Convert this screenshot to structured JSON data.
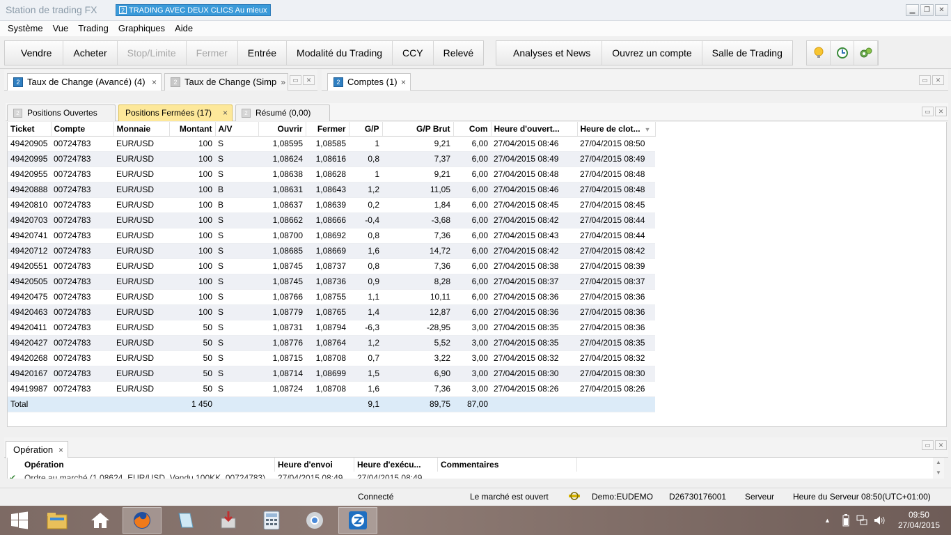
{
  "window": {
    "title": "Station de trading FX",
    "badge_num": "2",
    "badge_text": "TRADING AVEC DEUX CLICS Au mieux",
    "minimize": "▁",
    "restore": "❐",
    "close": "✕"
  },
  "menu": [
    "Système",
    "Vue",
    "Trading",
    "Graphiques",
    "Aide"
  ],
  "toolbar": {
    "group1": [
      {
        "label": "Vendre",
        "disabled": false
      },
      {
        "label": "Acheter",
        "disabled": false
      },
      {
        "label": "Stop/Limite",
        "disabled": true
      },
      {
        "label": "Fermer",
        "disabled": true
      },
      {
        "label": "Entrée",
        "disabled": false
      },
      {
        "label": "Modalité du Trading",
        "disabled": false
      },
      {
        "label": "CCY",
        "disabled": false
      },
      {
        "label": "Relevé",
        "disabled": false
      }
    ],
    "group2": [
      "Analyses et News",
      "Ouvrez un compte",
      "Salle de Trading"
    ],
    "icons": [
      "lightbulb-icon",
      "clock-icon",
      "gears-icon"
    ]
  },
  "panels": {
    "left_tabs": [
      {
        "num": "2",
        "label": "Taux de Change (Avancé) (4)",
        "close": "×"
      },
      {
        "num": "2",
        "label": "Taux de Change (Simp",
        "close": "»"
      }
    ],
    "right_tabs": [
      {
        "num": "2",
        "label": "Comptes (1)",
        "close": "×"
      }
    ]
  },
  "subtabs": [
    {
      "num": "2",
      "label": "Positions Ouvertes",
      "active": false,
      "close": ""
    },
    {
      "num": "",
      "label": "Positions Fermées (17)",
      "active": true,
      "close": "×"
    },
    {
      "num": "2",
      "label": "Résumé (0,00)",
      "active": false,
      "close": ""
    }
  ],
  "table": {
    "columns": [
      "Ticket",
      "Compte",
      "Monnaie",
      "Montant",
      "A/V",
      "Ouvrir",
      "Fermer",
      "G/P",
      "G/P Brut",
      "Com",
      "Heure d'ouvert...",
      "Heure de clot..."
    ],
    "sort_indicator": "▼",
    "rows": [
      [
        "49420905",
        "00724783",
        "EUR/USD",
        "100",
        "S",
        "1,08595",
        "1,08585",
        "1",
        "9,21",
        "6,00",
        "27/04/2015 08:46",
        "27/04/2015 08:50"
      ],
      [
        "49420995",
        "00724783",
        "EUR/USD",
        "100",
        "S",
        "1,08624",
        "1,08616",
        "0,8",
        "7,37",
        "6,00",
        "27/04/2015 08:49",
        "27/04/2015 08:49"
      ],
      [
        "49420955",
        "00724783",
        "EUR/USD",
        "100",
        "S",
        "1,08638",
        "1,08628",
        "1",
        "9,21",
        "6,00",
        "27/04/2015 08:48",
        "27/04/2015 08:48"
      ],
      [
        "49420888",
        "00724783",
        "EUR/USD",
        "100",
        "B",
        "1,08631",
        "1,08643",
        "1,2",
        "11,05",
        "6,00",
        "27/04/2015 08:46",
        "27/04/2015 08:48"
      ],
      [
        "49420810",
        "00724783",
        "EUR/USD",
        "100",
        "B",
        "1,08637",
        "1,08639",
        "0,2",
        "1,84",
        "6,00",
        "27/04/2015 08:45",
        "27/04/2015 08:45"
      ],
      [
        "49420703",
        "00724783",
        "EUR/USD",
        "100",
        "S",
        "1,08662",
        "1,08666",
        "-0,4",
        "-3,68",
        "6,00",
        "27/04/2015 08:42",
        "27/04/2015 08:44"
      ],
      [
        "49420741",
        "00724783",
        "EUR/USD",
        "100",
        "S",
        "1,08700",
        "1,08692",
        "0,8",
        "7,36",
        "6,00",
        "27/04/2015 08:43",
        "27/04/2015 08:44"
      ],
      [
        "49420712",
        "00724783",
        "EUR/USD",
        "100",
        "S",
        "1,08685",
        "1,08669",
        "1,6",
        "14,72",
        "6,00",
        "27/04/2015 08:42",
        "27/04/2015 08:42"
      ],
      [
        "49420551",
        "00724783",
        "EUR/USD",
        "100",
        "S",
        "1,08745",
        "1,08737",
        "0,8",
        "7,36",
        "6,00",
        "27/04/2015 08:38",
        "27/04/2015 08:39"
      ],
      [
        "49420505",
        "00724783",
        "EUR/USD",
        "100",
        "S",
        "1,08745",
        "1,08736",
        "0,9",
        "8,28",
        "6,00",
        "27/04/2015 08:37",
        "27/04/2015 08:37"
      ],
      [
        "49420475",
        "00724783",
        "EUR/USD",
        "100",
        "S",
        "1,08766",
        "1,08755",
        "1,1",
        "10,11",
        "6,00",
        "27/04/2015 08:36",
        "27/04/2015 08:36"
      ],
      [
        "49420463",
        "00724783",
        "EUR/USD",
        "100",
        "S",
        "1,08779",
        "1,08765",
        "1,4",
        "12,87",
        "6,00",
        "27/04/2015 08:36",
        "27/04/2015 08:36"
      ],
      [
        "49420411",
        "00724783",
        "EUR/USD",
        "50",
        "S",
        "1,08731",
        "1,08794",
        "-6,3",
        "-28,95",
        "3,00",
        "27/04/2015 08:35",
        "27/04/2015 08:36"
      ],
      [
        "49420427",
        "00724783",
        "EUR/USD",
        "50",
        "S",
        "1,08776",
        "1,08764",
        "1,2",
        "5,52",
        "3,00",
        "27/04/2015 08:35",
        "27/04/2015 08:35"
      ],
      [
        "49420268",
        "00724783",
        "EUR/USD",
        "50",
        "S",
        "1,08715",
        "1,08708",
        "0,7",
        "3,22",
        "3,00",
        "27/04/2015 08:32",
        "27/04/2015 08:32"
      ],
      [
        "49420167",
        "00724783",
        "EUR/USD",
        "50",
        "S",
        "1,08714",
        "1,08699",
        "1,5",
        "6,90",
        "3,00",
        "27/04/2015 08:30",
        "27/04/2015 08:30"
      ],
      [
        "49419987",
        "00724783",
        "EUR/USD",
        "50",
        "S",
        "1,08724",
        "1,08708",
        "1,6",
        "7,36",
        "3,00",
        "27/04/2015 08:26",
        "27/04/2015 08:26"
      ]
    ],
    "total": {
      "label": "Total",
      "montant": "1 450",
      "gp": "9,1",
      "gp_brut": "89,75",
      "com": "87,00"
    }
  },
  "operation": {
    "tab_label": "Opération",
    "tab_close": "×",
    "columns": [
      "Opération",
      "Heure d'envoi",
      "Heure d'exécu...",
      "Commentaires"
    ],
    "row_text": "Ordre au marché (1,08624, EUR/USD, Vendu 100KK, 00724783)",
    "row_send": "27/04/2015 08:49",
    "row_exec": "27/04/2015 08:49"
  },
  "status": {
    "connection": "Connecté",
    "market": "Le marché est ouvert",
    "account": "Demo:EUDEMO",
    "id": "D26730176001",
    "server": "Serveur",
    "server_time": "Heure du Serveur 08:50(UTC+01:00)"
  },
  "taskbar": {
    "time": "09:50",
    "date": "27/04/2015",
    "tray_up": "▲"
  },
  "colors": {
    "accent": "#3a9ad9",
    "active_tab": "#fde89a",
    "total_row": "#dcebf8"
  }
}
